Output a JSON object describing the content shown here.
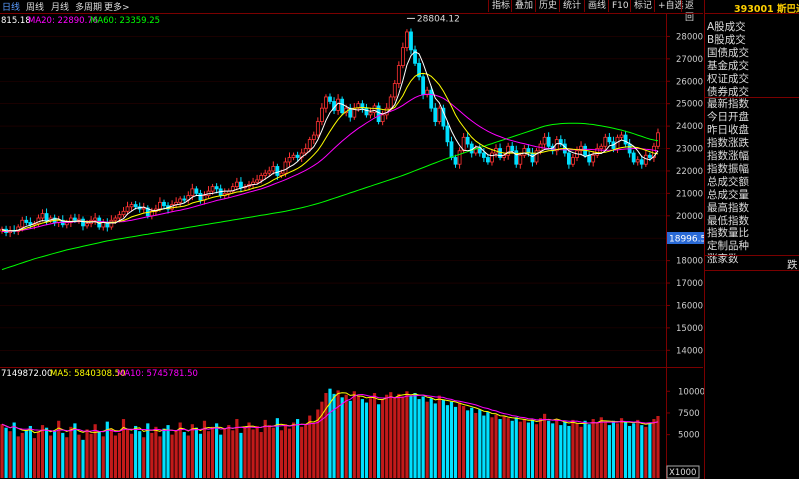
{
  "topbar": {
    "periods": [
      "日线",
      "周线",
      "月线",
      "多周期",
      "更多>"
    ],
    "tools": [
      "指标",
      "叠加",
      "历史",
      "统计",
      "画线",
      "F10",
      "标记",
      "+自选",
      "返回"
    ]
  },
  "price_indicators": {
    "ma5_value": "815.18",
    "ma20_label": "MA20: 22890.76",
    "ma60_label": "MA60: 23359.25"
  },
  "volume_indicators": {
    "vol_label": "7149872.00",
    "ma5_label": "MA5: 5840308.50",
    "ma10_label": "MA10: 5745781.50"
  },
  "side_panel": {
    "stock_title": "393001 斯巴达",
    "items": [
      "A股成交",
      "B股成交",
      "国债成交",
      "基金成交",
      "权证成交",
      "债券成交",
      "最新指数",
      "今日开盘",
      "昨日收盘",
      "指数涨跌",
      "指数涨幅",
      "指数振幅",
      "总成交额",
      "总成交量",
      "最高指数",
      "最低指数",
      "指数量比",
      "定制品种",
      "涨家数"
    ],
    "extra_right": "跌"
  },
  "colors": {
    "up": "#ff3333",
    "down": "#00e0ff",
    "ma5": "#ffffff",
    "ma10": "#ffff00",
    "ma20": "#ff00ff",
    "ma60": "#00ff00",
    "axis_text": "#cccccc",
    "grid": "#7a0000",
    "panel_text": "#dddddd",
    "accent": "#ffd000",
    "active_period": "#5a9cff",
    "last_price_bg": "#2a6ad6"
  },
  "chart_data": [
    {
      "type": "candlestick",
      "y_ticks": [
        14000,
        15000,
        16000,
        17000,
        18000,
        19000,
        20000,
        21000,
        22000,
        23000,
        24000,
        25000,
        26000,
        27000,
        28000
      ],
      "y_tick_labels": [
        "14000",
        "15000",
        "16000",
        "17000",
        "18000",
        "19000",
        "20000",
        "21000",
        "22000",
        "23000",
        "24000",
        "25000",
        "26000",
        "27000",
        "28000"
      ],
      "ylim": [
        13300,
        29000
      ],
      "peak_label": "28804.12",
      "last_price_label": "18996.5",
      "close": [
        19400,
        19250,
        19350,
        19300,
        19500,
        19800,
        19700,
        19600,
        19650,
        19900,
        20100,
        19800,
        19900,
        19700,
        19800,
        19600,
        19700,
        19900,
        19800,
        19850,
        19550,
        19650,
        19800,
        19900,
        19500,
        19700,
        19500,
        19800,
        19900,
        20050,
        20200,
        20400,
        20500,
        20400,
        20300,
        20350,
        20000,
        20200,
        20300,
        20600,
        20450,
        20300,
        20500,
        20600,
        20750,
        20700,
        20900,
        21200,
        21000,
        20700,
        20900,
        21100,
        21300,
        21200,
        20900,
        21000,
        21100,
        21300,
        21500,
        21250,
        21300,
        21400,
        21500,
        21600,
        21800,
        21900,
        22000,
        22200,
        21800,
        21900,
        22400,
        22600,
        22700,
        22600,
        22800,
        23000,
        23400,
        23600,
        24200,
        24800,
        25300,
        25100,
        24700,
        25200,
        24600,
        24800,
        24400,
        24800,
        25000,
        24800,
        24500,
        24600,
        24900,
        24200,
        24500,
        24800,
        25300,
        25900,
        26700,
        27500,
        28200,
        27400,
        26800,
        26200,
        25400,
        25600,
        24800,
        24200,
        24800,
        24000,
        23300,
        22600,
        22300,
        22900,
        23500,
        23200,
        22800,
        23000,
        22800,
        22600,
        22400,
        22800,
        23000,
        22600,
        22700,
        23100,
        22900,
        22300,
        22700,
        23000,
        22800,
        22400,
        22900,
        23200,
        23500,
        23100,
        22900,
        23400,
        23200,
        22800,
        22300,
        22600,
        22900,
        23100,
        22700,
        22400,
        22700,
        23000,
        23100,
        23500,
        23300,
        23000,
        23500,
        23600,
        23200,
        22800,
        22400,
        22500,
        22300,
        22700,
        22600,
        23100,
        23700
      ],
      "ma5": [
        19400,
        19320,
        19330,
        19330,
        19360,
        19440,
        19530,
        19580,
        19650,
        19730,
        19790,
        19760,
        19820,
        19860,
        19860,
        19760,
        19740,
        19740,
        19760,
        19770,
        19740,
        19710,
        19720,
        19740,
        19660,
        19710,
        19680,
        19680,
        19680,
        19790,
        19870,
        20080,
        20210,
        20330,
        20360,
        20390,
        20310,
        20250,
        20230,
        20290,
        20310,
        20370,
        20430,
        20490,
        20520,
        20570,
        20690,
        20830,
        20910,
        20900,
        20940,
        20980,
        21000,
        21040,
        21080,
        21100,
        21100,
        21120,
        21180,
        21230,
        21290,
        21350,
        21390,
        21410,
        21520,
        21640,
        21760,
        21900,
        21940,
        22000,
        22060,
        22180,
        22280,
        22420,
        22620,
        22740,
        22900,
        23080,
        23400,
        23800,
        24260,
        24600,
        24820,
        25020,
        24980,
        24880,
        24780,
        24740,
        24720,
        24760,
        24700,
        24660,
        24700,
        24600,
        24540,
        24600,
        24740,
        24960,
        25440,
        26040,
        26720,
        27140,
        27320,
        27220,
        26800,
        26280,
        25760,
        25240,
        25040,
        24620,
        24220,
        23780,
        23440,
        23140,
        22920,
        22900,
        22940,
        23080,
        23060,
        22880,
        22720,
        22680,
        22720,
        22680,
        22700,
        22840,
        22860,
        22720,
        22760,
        22800,
        22740,
        22640,
        22760,
        22860,
        22960,
        22980,
        23020,
        23220,
        23220,
        23080,
        22900,
        22820,
        22760,
        22740,
        22640,
        22700,
        22760,
        22780,
        22780,
        22900,
        23120,
        23160,
        23280,
        23380,
        23320,
        23220,
        23100,
        22900,
        22640,
        22540,
        22500,
        22640,
        22900
      ],
      "ma10": [
        19350,
        19320,
        19330,
        19330,
        19350,
        19390,
        19450,
        19500,
        19560,
        19620,
        19680,
        19720,
        19760,
        19800,
        19810,
        19780,
        19760,
        19750,
        19750,
        19760,
        19760,
        19740,
        19740,
        19730,
        19700,
        19700,
        19690,
        19710,
        19720,
        19760,
        19790,
        19860,
        19950,
        20010,
        20060,
        20120,
        20150,
        20180,
        20210,
        20260,
        20310,
        20340,
        20360,
        20380,
        20400,
        20430,
        20490,
        20570,
        20620,
        20660,
        20710,
        20760,
        20820,
        20860,
        20890,
        20920,
        20960,
        21010,
        21060,
        21080,
        21120,
        21170,
        21230,
        21270,
        21320,
        21400,
        21490,
        21600,
        21690,
        21770,
        21850,
        21940,
        22020,
        22110,
        22230,
        22370,
        22540,
        22720,
        22920,
        23180,
        23480,
        23770,
        24040,
        24300,
        24500,
        24650,
        24760,
        24800,
        24820,
        24830,
        24820,
        24800,
        24790,
        24780,
        24740,
        24720,
        24740,
        24840,
        25080,
        25360,
        25720,
        26020,
        26220,
        26330,
        26350,
        26320,
        26220,
        26040,
        25840,
        25560,
        25230,
        24880,
        24500,
        24200,
        23960,
        23720,
        23500,
        23330,
        23210,
        23100,
        23020,
        22950,
        22890,
        22830,
        22800,
        22790,
        22800,
        22780,
        22790,
        22800,
        22810,
        22790,
        22790,
        22820,
        22860,
        22900,
        22910,
        22950,
        22990,
        23000,
        22990,
        22970,
        22950,
        22940,
        22920,
        22890,
        22850,
        22820,
        22810,
        22830,
        22880,
        22940,
        23000,
        23040,
        23070,
        23080,
        23070,
        23040,
        22980,
        22920,
        22860,
        22790,
        22760
      ],
      "ma20": [
        19300,
        19300,
        19310,
        19320,
        19330,
        19360,
        19390,
        19430,
        19470,
        19510,
        19560,
        19600,
        19640,
        19680,
        19700,
        19710,
        19710,
        19720,
        19730,
        19740,
        19750,
        19750,
        19750,
        19750,
        19740,
        19730,
        19720,
        19720,
        19720,
        19730,
        19740,
        19770,
        19800,
        19840,
        19880,
        19920,
        19960,
        19990,
        20020,
        20060,
        20100,
        20140,
        20180,
        20220,
        20250,
        20290,
        20330,
        20380,
        20430,
        20480,
        20530,
        20580,
        20630,
        20680,
        20720,
        20760,
        20800,
        20850,
        20900,
        20950,
        21000,
        21050,
        21100,
        21150,
        21200,
        21260,
        21330,
        21400,
        21470,
        21540,
        21610,
        21690,
        21770,
        21850,
        21940,
        22030,
        22130,
        22240,
        22360,
        22500,
        22660,
        22830,
        23000,
        23170,
        23330,
        23480,
        23630,
        23770,
        23900,
        24020,
        24140,
        24250,
        24360,
        24460,
        24540,
        24600,
        24660,
        24730,
        24820,
        24930,
        25050,
        25170,
        25270,
        25350,
        25400,
        25420,
        25410,
        25380,
        25320,
        25240,
        25120,
        24980,
        24830,
        24680,
        24520,
        24370,
        24230,
        24100,
        23980,
        23870,
        23770,
        23680,
        23600,
        23530,
        23460,
        23400,
        23350,
        23300,
        23250,
        23210,
        23170,
        23120,
        23080,
        23050,
        23020,
        23000,
        22980,
        22960,
        22950,
        22940,
        22940,
        22940,
        22950,
        22960,
        22960,
        22960,
        22950,
        22940,
        22930,
        22920,
        22920,
        22930,
        22940,
        22960,
        22980,
        22990,
        23000,
        23000,
        22990,
        22970,
        22950,
        22920,
        22890
      ],
      "ma60": [
        17600,
        17660,
        17720,
        17780,
        17840,
        17900,
        17960,
        18020,
        18080,
        18130,
        18180,
        18230,
        18280,
        18330,
        18380,
        18430,
        18480,
        18520,
        18560,
        18600,
        18640,
        18680,
        18720,
        18760,
        18800,
        18840,
        18880,
        18910,
        18940,
        18970,
        19000,
        19030,
        19060,
        19090,
        19120,
        19150,
        19180,
        19210,
        19240,
        19270,
        19300,
        19330,
        19360,
        19390,
        19420,
        19450,
        19480,
        19510,
        19540,
        19570,
        19600,
        19630,
        19660,
        19690,
        19720,
        19750,
        19780,
        19810,
        19840,
        19870,
        19900,
        19930,
        19960,
        19990,
        20020,
        20050,
        20080,
        20110,
        20140,
        20170,
        20200,
        20240,
        20280,
        20320,
        20360,
        20400,
        20450,
        20500,
        20550,
        20600,
        20660,
        20720,
        20780,
        20840,
        20900,
        20960,
        21020,
        21080,
        21140,
        21200,
        21260,
        21320,
        21380,
        21440,
        21500,
        21560,
        21620,
        21680,
        21740,
        21800,
        21870,
        21940,
        22010,
        22080,
        22150,
        22220,
        22290,
        22360,
        22430,
        22500,
        22560,
        22620,
        22680,
        22740,
        22800,
        22860,
        22920,
        22980,
        23040,
        23100,
        23160,
        23220,
        23280,
        23340,
        23400,
        23460,
        23520,
        23580,
        23640,
        23700,
        23760,
        23820,
        23880,
        23940,
        24000,
        24040,
        24070,
        24090,
        24110,
        24120,
        24130,
        24130,
        24130,
        24120,
        24110,
        24090,
        24070,
        24040,
        24010,
        23980,
        23940,
        23900,
        23860,
        23820,
        23770,
        23720,
        23660,
        23600,
        23540,
        23480,
        23420,
        23380,
        23350
      ]
    },
    {
      "type": "bar",
      "y_ticks": [
        5000,
        7500,
        10000
      ],
      "y_tick_labels": [
        "5000",
        "7500",
        "10000"
      ],
      "ylim": [
        0,
        11300
      ],
      "unit_label": "X1000",
      "values": [
        6200,
        5800,
        5400,
        6400,
        4800,
        5200,
        5500,
        6000,
        4600,
        5300,
        6100,
        5800,
        4900,
        5400,
        6600,
        5200,
        4700,
        5900,
        6300,
        5000,
        4400,
        5600,
        5100,
        6200,
        5300,
        4800,
        6500,
        5700,
        4900,
        5200,
        6800,
        5600,
        5100,
        6000,
        5400,
        4700,
        6300,
        5200,
        5900,
        4800,
        5700,
        6100,
        5000,
        5500,
        6400,
        5300,
        4900,
        6200,
        5800,
        5100,
        6600,
        5400,
        5900,
        6300,
        5000,
        5700,
        6100,
        5500,
        6800,
        5200,
        5900,
        6400,
        5600,
        6000,
        5300,
        6700,
        6100,
        5800,
        6900,
        5500,
        6200,
        5700,
        6400,
        6800,
        5900,
        6100,
        7200,
        6300,
        7900,
        8800,
        9800,
        10300,
        9700,
        10100,
        9300,
        9600,
        8900,
        10000,
        9500,
        9100,
        8700,
        9200,
        9800,
        8500,
        9000,
        9600,
        9900,
        9300,
        9700,
        9400,
        10000,
        9500,
        9800,
        9100,
        9400,
        8800,
        9200,
        8600,
        9500,
        9000,
        8400,
        8800,
        8200,
        8700,
        8300,
        7800,
        8100,
        7500,
        7900,
        7200,
        7600,
        7000,
        7300,
        6800,
        7100,
        6900,
        6600,
        7000,
        6500,
        6800,
        6400,
        6700,
        6200,
        6900,
        7400,
        6600,
        6300,
        6800,
        6100,
        6500,
        6000,
        6700,
        6300,
        5900,
        6600,
        6200,
        6800,
        6400,
        7000,
        6500,
        6100,
        6600,
        6300,
        6900,
        6400,
        6000,
        6300,
        6700,
        6100,
        5900,
        6400,
        6800,
        7149
      ]
    }
  ]
}
